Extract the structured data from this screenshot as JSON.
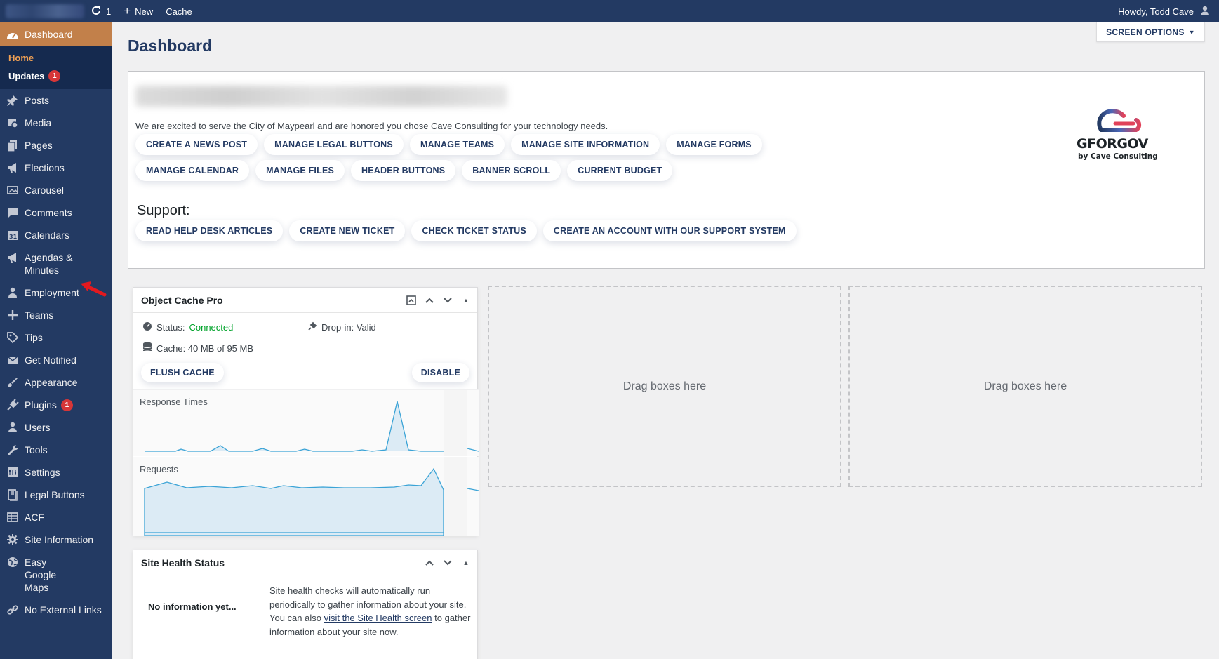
{
  "adminbar": {
    "updates_count": "1",
    "new_label": "New",
    "cache_label": "Cache",
    "howdy": "Howdy, Todd Cave"
  },
  "sidebar": {
    "dashboard": "Dashboard",
    "submenu": [
      {
        "label": "Home"
      },
      {
        "label": "Updates",
        "badge": "1"
      }
    ],
    "items": [
      {
        "label": "Posts",
        "icon": "pin-icon"
      },
      {
        "label": "Media",
        "icon": "media-icon"
      },
      {
        "label": "Pages",
        "icon": "pages-icon"
      },
      {
        "label": "Elections",
        "icon": "megaphone-icon"
      },
      {
        "label": "Carousel",
        "icon": "carousel-icon"
      },
      {
        "label": "Comments",
        "icon": "comments-icon"
      },
      {
        "label": "Calendars",
        "icon": "calendar-icon"
      },
      {
        "label": "Agendas & Minutes",
        "icon": "megaphone-icon"
      },
      {
        "label": "Employment",
        "icon": "person-icon"
      },
      {
        "label": "Teams",
        "icon": "plus-icon"
      },
      {
        "label": "Tips",
        "icon": "tag-icon"
      },
      {
        "label": "Get Notified",
        "icon": "email-icon"
      },
      {
        "label": "Appearance",
        "icon": "brush-icon"
      },
      {
        "label": "Plugins",
        "icon": "plugin-icon",
        "badge": "1"
      },
      {
        "label": "Users",
        "icon": "users-icon"
      },
      {
        "label": "Tools",
        "icon": "wrench-icon"
      },
      {
        "label": "Settings",
        "icon": "settings-icon"
      },
      {
        "label": "Legal Buttons",
        "icon": "book-icon"
      },
      {
        "label": "ACF",
        "icon": "table-icon"
      },
      {
        "label": "Site Information",
        "icon": "gear-icon"
      },
      {
        "label": "Easy Google Maps",
        "icon": "globe-icon"
      },
      {
        "label": "No External Links",
        "icon": "link-icon"
      }
    ]
  },
  "page": {
    "title": "Dashboard",
    "screen_options": "SCREEN OPTIONS"
  },
  "welcome": {
    "intro": "We are excited to serve the City of Maypearl and are honored you chose Cave Consulting for your technology needs.",
    "row1": [
      "CREATE A NEWS POST",
      "MANAGE LEGAL BUTTONS",
      "MANAGE TEAMS",
      "MANAGE SITE INFORMATION",
      "MANAGE FORMS"
    ],
    "row2": [
      "MANAGE CALENDAR",
      "MANAGE FILES",
      "HEADER BUTTONS",
      "BANNER SCROLL",
      "CURRENT BUDGET"
    ],
    "support_heading": "Support:",
    "row3": [
      "READ HELP DESK ARTICLES",
      "CREATE NEW TICKET",
      "CHECK TICKET STATUS",
      "CREATE AN ACCOUNT WITH OUR SUPPORT SYSTEM"
    ],
    "logo": {
      "brand": "GFORGOV",
      "byline": "by Cave Consulting"
    }
  },
  "object_cache": {
    "title": "Object Cache Pro",
    "status_label": "Status:",
    "status_value": "Connected",
    "dropin": "Drop-in: Valid",
    "cache": "Cache: 40 MB of 95 MB",
    "flush": "FLUSH CACHE",
    "disable": "DISABLE",
    "response_label": "Response Times",
    "requests_label": "Requests"
  },
  "dropzones": [
    "Drag boxes here",
    "Drag boxes here"
  ],
  "site_health": {
    "title": "Site Health Status",
    "no_info": "No information yet...",
    "text_before": "Site health checks will automatically run periodically to gather information about your site. You can also ",
    "link": "visit the Site Health screen",
    "text_after": " to gather information about your site now."
  },
  "colors": {
    "sidebar_bg": "#233a63",
    "sidebar_active": "#c2804a",
    "submenu_bg": "#152a4f",
    "badge": "#d63638",
    "connected": "#00a32a",
    "chart_line": "#3aa3d6"
  }
}
